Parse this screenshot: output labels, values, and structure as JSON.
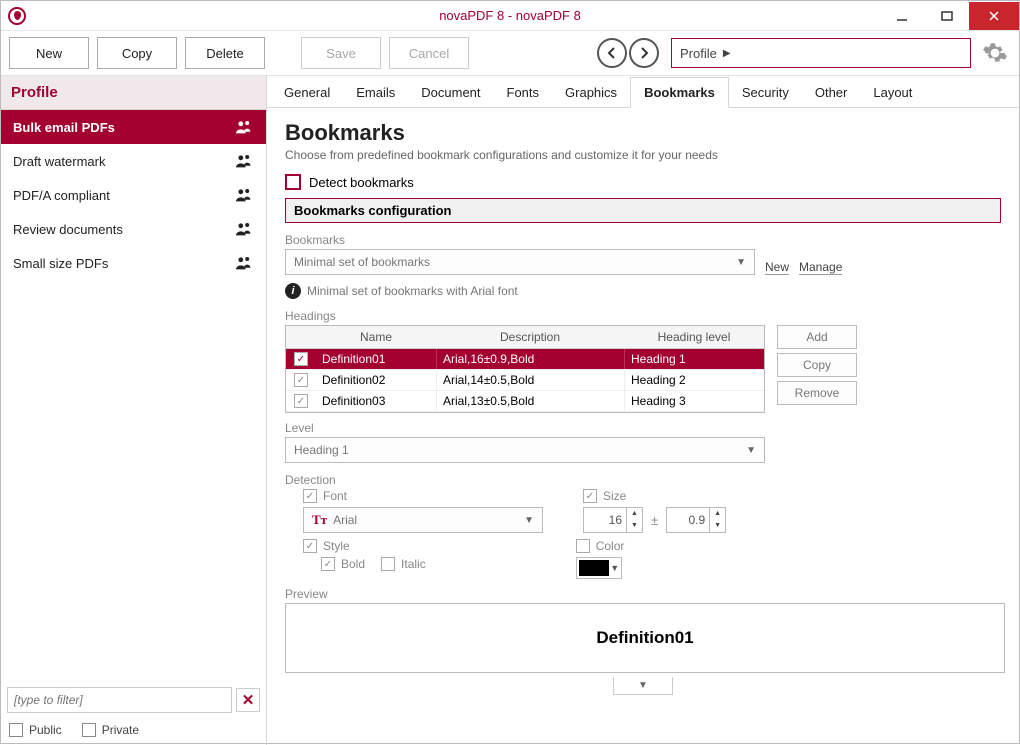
{
  "window": {
    "title": "novaPDF 8 - novaPDF 8"
  },
  "toolbar": {
    "new": "New",
    "copy": "Copy",
    "delete": "Delete",
    "save": "Save",
    "cancel": "Cancel",
    "profile_label": "Profile"
  },
  "sidebar": {
    "header": "Profile",
    "items": [
      {
        "label": "Bulk email PDFs",
        "active": true
      },
      {
        "label": "Draft watermark"
      },
      {
        "label": "PDF/A compliant"
      },
      {
        "label": "Review documents"
      },
      {
        "label": "Small size PDFs"
      }
    ],
    "filter_placeholder": "[type to filter]",
    "public": "Public",
    "private": "Private"
  },
  "tabs": [
    "General",
    "Emails",
    "Document",
    "Fonts",
    "Graphics",
    "Bookmarks",
    "Security",
    "Other",
    "Layout"
  ],
  "active_tab": "Bookmarks",
  "page": {
    "title": "Bookmarks",
    "subtitle": "Choose from predefined bookmark configurations and customize it for your needs",
    "detect": "Detect bookmarks",
    "section": "Bookmarks configuration",
    "bookmarks_label": "Bookmarks",
    "bookmarks_combo": "Minimal set of bookmarks",
    "new_link": "New",
    "manage_link": "Manage",
    "info_text": "Minimal set of bookmarks with Arial font",
    "headings_label": "Headings",
    "columns": {
      "name": "Name",
      "description": "Description",
      "heading": "Heading level"
    },
    "rows": [
      {
        "name": "Definition01",
        "desc": "Arial,16±0.9,Bold",
        "heading": "Heading 1",
        "sel": true
      },
      {
        "name": "Definition02",
        "desc": "Arial,14±0.5,Bold",
        "heading": "Heading 2"
      },
      {
        "name": "Definition03",
        "desc": "Arial,13±0.5,Bold",
        "heading": "Heading 3"
      }
    ],
    "add": "Add",
    "copy": "Copy",
    "remove": "Remove",
    "level_label": "Level",
    "level_value": "Heading 1",
    "detection_label": "Detection",
    "font_label": "Font",
    "font_value": "Arial",
    "size_label": "Size",
    "size_value": "16",
    "tolerance": "0.9",
    "style_label": "Style",
    "bold": "Bold",
    "italic": "Italic",
    "color_label": "Color",
    "preview_label": "Preview",
    "preview_text": "Definition01"
  }
}
